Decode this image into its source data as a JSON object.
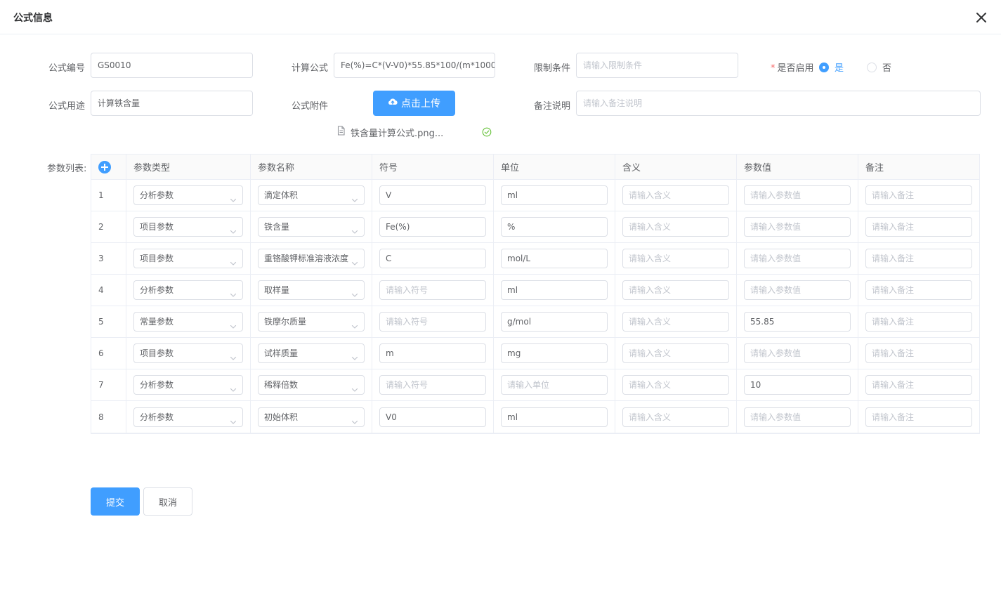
{
  "dialog": {
    "title": "公式信息"
  },
  "form": {
    "code_label": "公式编号",
    "code_value": "GS0010",
    "formula_label": "计算公式",
    "formula_value": "Fe(%)=C*(V-V0)*55.85*100/(m*1000",
    "limit_label": "限制条件",
    "limit_placeholder": "请输入限制条件",
    "enable_label": "是否启用",
    "enable_required_mark": "*",
    "enable_options": [
      "是",
      "否"
    ],
    "enable_selected": "是",
    "purpose_label": "公式用途",
    "purpose_value": "计算铁含量",
    "attachment_label": "公式附件",
    "upload_label": "点击上传",
    "attachment_file": "铁含量计算公式.png...",
    "remark_label": "备注说明",
    "remark_placeholder": "请输入备注说明",
    "params_label": "参数列表:"
  },
  "table": {
    "headers": [
      "参数类型",
      "参数名称",
      "符号",
      "单位",
      "含义",
      "参数值",
      "备注"
    ],
    "placeholders": {
      "symbol": "请输入符号",
      "unit": "请输入单位",
      "meaning": "请输入含义",
      "value": "请输入参数值",
      "remark": "请输入备注"
    },
    "rows": [
      {
        "index": "1",
        "type": "分析参数",
        "name": "滴定体积",
        "symbol": "V",
        "unit": "ml",
        "meaning": "",
        "value": "",
        "remark": ""
      },
      {
        "index": "2",
        "type": "项目参数",
        "name": "铁含量",
        "symbol": "Fe(%)",
        "unit": "%",
        "meaning": "",
        "value": "",
        "remark": ""
      },
      {
        "index": "3",
        "type": "项目参数",
        "name": "重铬酸钾标准溶液浓度",
        "symbol": "C",
        "unit": "mol/L",
        "meaning": "",
        "value": "",
        "remark": ""
      },
      {
        "index": "4",
        "type": "分析参数",
        "name": "取样量",
        "symbol": "",
        "unit": "ml",
        "meaning": "",
        "value": "",
        "remark": ""
      },
      {
        "index": "5",
        "type": "常量参数",
        "name": "铁摩尔质量",
        "symbol": "",
        "unit": "g/mol",
        "meaning": "",
        "value": "55.85",
        "remark": ""
      },
      {
        "index": "6",
        "type": "项目参数",
        "name": "试样质量",
        "symbol": "m",
        "unit": "mg",
        "meaning": "",
        "value": "",
        "remark": ""
      },
      {
        "index": "7",
        "type": "分析参数",
        "name": "稀释倍数",
        "symbol": "",
        "unit": "",
        "meaning": "",
        "value": "10",
        "remark": ""
      },
      {
        "index": "8",
        "type": "分析参数",
        "name": "初始体积",
        "symbol": "V0",
        "unit": "ml",
        "meaning": "",
        "value": "",
        "remark": ""
      }
    ]
  },
  "actions": {
    "submit_label": "提交",
    "cancel_label": "取消"
  },
  "colors": {
    "primary": "#409eff",
    "border": "#dcdfe6",
    "placeholder": "#c0c4cc",
    "success": "#67c23a"
  }
}
